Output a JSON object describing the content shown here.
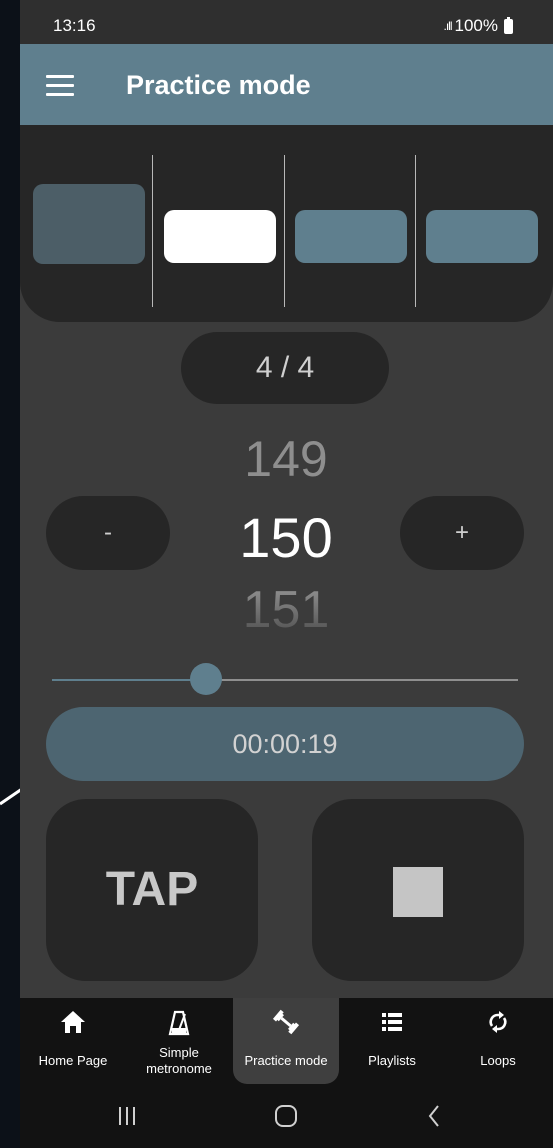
{
  "status_bar": {
    "time": "13:16",
    "signal": ".ıll",
    "battery": "100%"
  },
  "app_bar": {
    "title": "Practice mode"
  },
  "beats": {
    "count": 4,
    "colors": [
      "#4c5e67",
      "#ffffff",
      "#5f7f8e",
      "#5f7f8e"
    ]
  },
  "time_signature": "4 / 4",
  "tempo": {
    "previous": "149",
    "current": "150",
    "next": "151",
    "decrement_label": "-",
    "increment_label": "+"
  },
  "tempo_slider": {
    "value_fraction": 0.33
  },
  "timer": "00:00:19",
  "buttons": {
    "tap_label": "TAP"
  },
  "bottom_nav": {
    "items": [
      {
        "label": "Home Page",
        "icon": "home-icon"
      },
      {
        "label": "Simple metronome",
        "icon": "metronome-icon"
      },
      {
        "label": "Practice mode",
        "icon": "dumbbell-icon",
        "active": true
      },
      {
        "label": "Playlists",
        "icon": "list-icon"
      },
      {
        "label": "Loops",
        "icon": "loop-icon"
      }
    ]
  },
  "system_nav": [
    "recent-apps-icon",
    "home-circle-icon",
    "back-icon"
  ],
  "colors": {
    "accent": "#5f7f8e",
    "background": "#3b3b3b",
    "panel": "#262626"
  }
}
